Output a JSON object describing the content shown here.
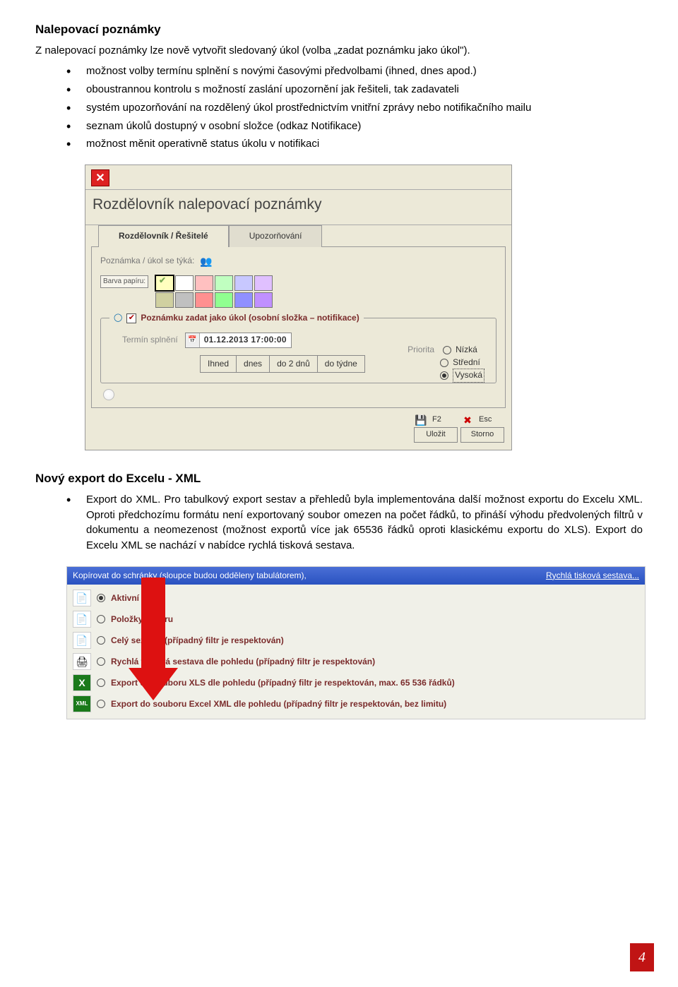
{
  "section1": {
    "title": "Nalepovací poznámky",
    "lead": "Z nalepovací poznámky lze nově vytvořit sledovaný úkol (volba „zadat poznámku jako úkol\").",
    "bullets": [
      "možnost volby termínu splnění s novými časovými předvolbami (ihned, dnes apod.)",
      "oboustrannou kontrolu s možností zaslání upozornění jak řešiteli, tak zadavateli",
      "systém upozorňování na rozdělený úkol prostřednictvím vnitřní zprávy nebo notifikačního mailu",
      "seznam úkolů dostupný v osobní složce (odkaz Notifikace)",
      "možnost měnit operativně status úkolu v notifikaci"
    ]
  },
  "dialog1": {
    "heading": "Rozdělovník nalepovací poznámky",
    "tab1": "Rozdělovník / Řešitelé",
    "tab2": "Upozorňování",
    "note_label": "Poznámka / úkol se týká:",
    "barva": "Barva papíru:",
    "palette": [
      "#ffffbf",
      "#ffffff",
      "#ffc0c0",
      "#c0ffc0",
      "#c8c8ff",
      "#e0c0ff",
      "#d0d0a0",
      "#c0c0c0",
      "#ff9090",
      "#90ff90",
      "#9090ff",
      "#c090ff"
    ],
    "task_check": "Poznámku zadat jako úkol (osobní složka – notifikace)",
    "termin_label": "Termín splnění",
    "termin_value": "01.12.2013 17:00:00",
    "buttons": [
      "Ihned",
      "dnes",
      "do 2 dnů",
      "do týdne"
    ],
    "prio_label": "Priorita",
    "prio_opts": [
      "Nízká",
      "Střední",
      "Vysoká"
    ],
    "prio_selected": 2,
    "f2": "F2",
    "esc": "Esc",
    "save": "Uložit",
    "storno": "Storno"
  },
  "section2": {
    "title": "Nový export do Excelu - XML",
    "bullet_strong": "Export do XML.",
    "bullet_rest": " Pro tabulkový export sestav a přehledů byla implementována další možnost exportu do Excelu XML. Oproti předchozímu formátu není exportovaný soubor omezen na počet řádků, to přináší výhodu předvolených filtrů v dokumentu a neomezenost (možnost exportů více jak 65536 řádků oproti klasickému exportu do XLS). Export do Excelu XML se nachází v nabídce rychlá tisková sestava."
  },
  "dialog2": {
    "titlebar_left": "Kopírovat do schránky (sloupce budou odděleny tabulátorem),",
    "titlebar_right": "Rychlá tisková sestava...",
    "rows": [
      {
        "icon": "📄",
        "label": "Aktivní řádek",
        "sel": true
      },
      {
        "icon": "📄",
        "label": "Položky výběru",
        "sel": false
      },
      {
        "icon": "📄",
        "label": "Celý seznam (případný filtr je respektován)",
        "sel": false
      },
      {
        "icon": "🖨",
        "label": "Rychlá tisková sestava dle pohledu (případný filtr je respektován)",
        "sel": false
      },
      {
        "icon": "X",
        "label": "Export do souboru XLS dle pohledu (případný filtr je respektován, max. 65 536 řádků)",
        "sel": false
      },
      {
        "icon": "XML",
        "label": "Export do souboru Excel XML dle pohledu (případný filtr je respektován, bez limitu)",
        "sel": false
      }
    ]
  },
  "page": "4"
}
